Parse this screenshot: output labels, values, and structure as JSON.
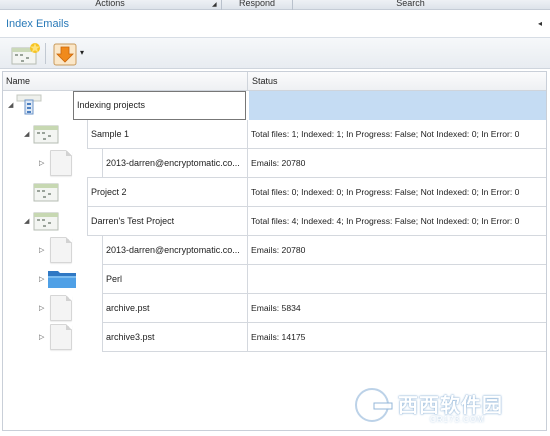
{
  "ribbon": {
    "tabs": [
      {
        "label": "Actions"
      },
      {
        "label": "Respond"
      },
      {
        "label": "Search"
      }
    ]
  },
  "panel": {
    "title": "Index Emails",
    "collapse_glyph": "◂"
  },
  "toolbar": {
    "add_project_icon": "new-project-icon",
    "dropdown_icon": "download-arrow-icon",
    "dropdown_caret": "▾"
  },
  "grid": {
    "columns": {
      "name": "Name",
      "status": "Status"
    },
    "rows": [
      {
        "name": "Indexing projects",
        "status": "",
        "icon": "server-icon",
        "expander": "◢"
      },
      {
        "name": "Sample 1",
        "status": "Total files: 1; Indexed: 1; In Progress: False; Not Indexed: 0; In Error: 0",
        "icon": "project-icon",
        "expander": "◢"
      },
      {
        "name": "2013-darren@encryptomatic.co...",
        "status": "Emails: 20780",
        "icon": "document-icon",
        "expander": "▷"
      },
      {
        "name": "Project 2",
        "status": "Total files: 0; Indexed: 0; In Progress: False; Not Indexed: 0; In Error: 0",
        "icon": "project-icon",
        "expander": ""
      },
      {
        "name": "Darren's Test Project",
        "status": "Total files: 4; Indexed: 4; In Progress: False; Not Indexed: 0; In Error: 0",
        "icon": "project-icon",
        "expander": "◢"
      },
      {
        "name": "2013-darren@encryptomatic.co...",
        "status": "Emails: 20780",
        "icon": "document-icon",
        "expander": "▷"
      },
      {
        "name": "Perl",
        "status": "",
        "icon": "folder-icon",
        "expander": "▷"
      },
      {
        "name": "archive.pst",
        "status": "Emails: 5834",
        "icon": "document-icon",
        "expander": "▷"
      },
      {
        "name": "archive3.pst",
        "status": "Emails: 14175",
        "icon": "document-icon",
        "expander": "▷"
      }
    ]
  },
  "watermark": {
    "brand": "西西软件园",
    "url": "CR173.COM"
  },
  "colors": {
    "title_blue": "#2a7ab8",
    "selection": "#c5dcf3",
    "folder_blue": "#3d8fd6",
    "arrow_orange": "#f08a1c"
  }
}
